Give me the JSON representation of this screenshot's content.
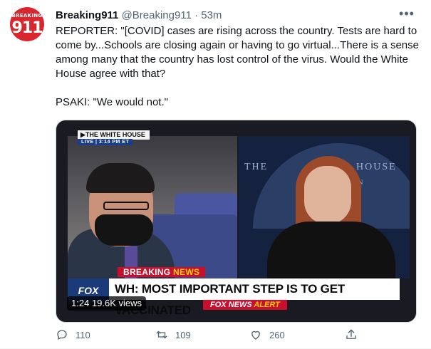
{
  "account": {
    "avatar_top": "BREAKING",
    "avatar_num": "911",
    "display_name": "Breaking911",
    "handle": "@Breaking911",
    "separator": "·",
    "time": "53m"
  },
  "more_label": "•••",
  "tweet": {
    "paragraph1": "REPORTER: \"[COVID] cases are rising across the country. Tests are hard to come by...Schools are closing again or having to go virtual...There is a sense among many that the country has lost control of the virus. Would the White House agree with that?",
    "paragraph2": "PSAKI: \"We would not.\""
  },
  "video": {
    "tag_location": "▶THE WHITE HOUSE",
    "tag_live": "LIVE  |  3:14 PM ET",
    "seal_left": "THE",
    "seal_right": "HOUSE",
    "seal_mid": "TON",
    "breaking_word": "BREAKING",
    "news_word": "NEWS",
    "fox_logo": "FOX",
    "headline": "WH: MOST IMPORTANT STEP IS TO GET VACCINATED",
    "alert_brand": "FOX NEWS",
    "alert_word": "ALERT",
    "duration": "1:24",
    "views": "19.6K views"
  },
  "actions": {
    "reply_count": "110",
    "retweet_count": "109",
    "like_count": "260"
  }
}
